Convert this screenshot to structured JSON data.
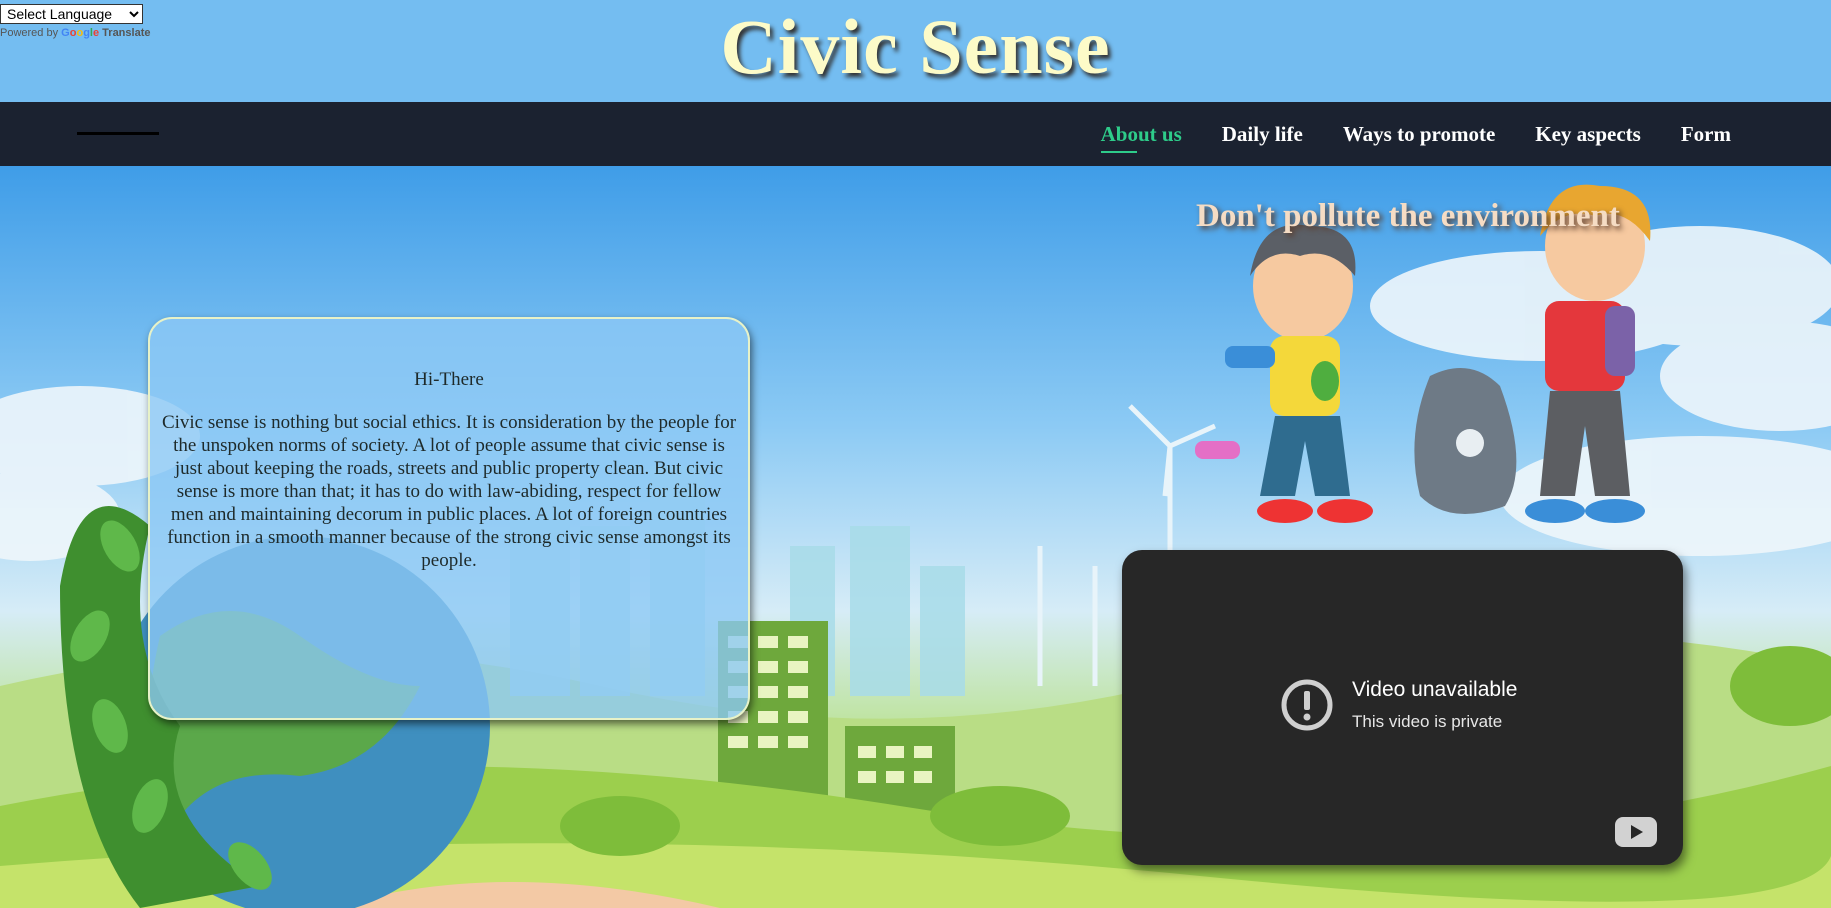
{
  "translate": {
    "select_label": "Select Language",
    "powered_by": "Powered by",
    "google": [
      "G",
      "o",
      "o",
      "g",
      "l",
      "e"
    ],
    "translate_label": "Translate"
  },
  "header": {
    "title": "Civic Sense"
  },
  "nav": {
    "items": [
      {
        "label": "About us",
        "active": true
      },
      {
        "label": "Daily life"
      },
      {
        "label": "Ways to promote"
      },
      {
        "label": "Key aspects"
      },
      {
        "label": "Form"
      }
    ]
  },
  "card": {
    "title": "Hi-There",
    "text": "Civic sense is nothing but social ethics. It is consideration by the people for the unspoken norms of society. A lot of people assume that civic sense is just about keeping the roads, streets and public property clean. But civic sense is more than that; it has to do with law-abiding, respect for fellow men and maintaining decorum in public places. A lot of foreign countries function in a smooth manner because of the strong civic sense amongst its people."
  },
  "slogan": "Don't pollute the environment",
  "video": {
    "title": "Video unavailable",
    "subtitle": "This video is private",
    "icon": "alert-circle-icon",
    "logo": "youtube-icon"
  },
  "colors": {
    "header_bg": "#74bdf1",
    "nav_bg": "#1b2230",
    "nav_active": "#2ecc8a",
    "title_color": "#fdfbc8",
    "video_bg": "#272727"
  }
}
